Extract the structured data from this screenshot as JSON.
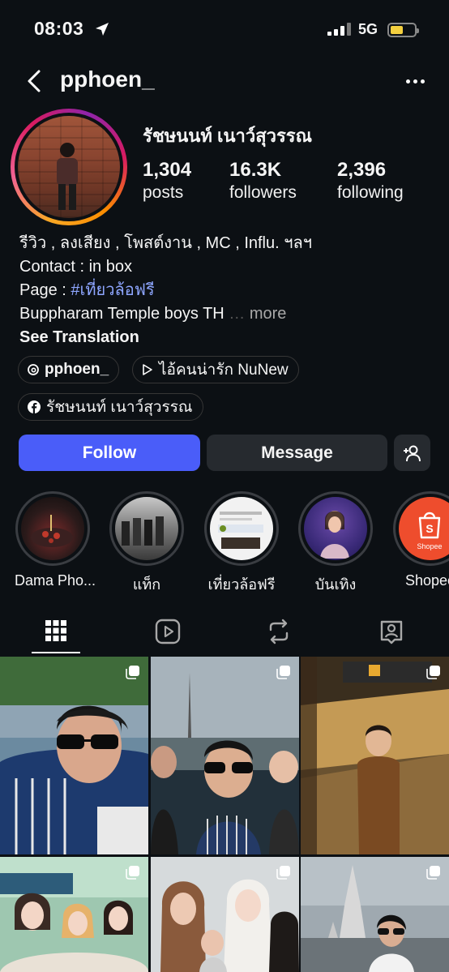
{
  "status_bar": {
    "time": "08:03",
    "network": "5G",
    "battery_color": "#f4d03f"
  },
  "header": {
    "username": "pphoen_"
  },
  "profile": {
    "full_name": "รัชษนนท์ เนาว์สุวรรณ",
    "stats": [
      {
        "value": "1,304",
        "label": "posts"
      },
      {
        "value": "16.3K",
        "label": "followers"
      },
      {
        "value": "2,396",
        "label": "following"
      }
    ],
    "bio": {
      "line1": "รีวิว , ลงเสียง , โพสต์งาน , MC  , Influ. ฯลฯ",
      "line2": "Contact : in box",
      "line3_prefix": "Page : ",
      "line3_hashtag": "#เที่ยวล้อฟรี",
      "line4": "Buppharam Temple boys TH",
      "more": "more",
      "see_translation": "See Translation"
    },
    "links": [
      {
        "icon": "threads-icon",
        "label": "pphoen_"
      },
      {
        "icon": "play-icon",
        "label": "ไอ้คนน่ารัก NuNew"
      },
      {
        "icon": "facebook-icon",
        "label": "รัชษนนท์ เนาว์สุวรรณ"
      }
    ]
  },
  "actions": {
    "follow": "Follow",
    "message": "Message",
    "follow_color": "#4a5df9"
  },
  "highlights": [
    {
      "label": "Dama Pho..."
    },
    {
      "label": "แท็ก"
    },
    {
      "label": "เที่ยวล้อฟรี"
    },
    {
      "label": "บันเทิง"
    },
    {
      "label": "Shopee"
    }
  ],
  "tabs": [
    {
      "icon": "grid-icon",
      "active": true
    },
    {
      "icon": "reels-icon",
      "active": false
    },
    {
      "icon": "reposts-icon",
      "active": false
    },
    {
      "icon": "tagged-icon",
      "active": false
    }
  ],
  "shopee_badge": "Shopee",
  "shopee_color": "#ee4d2d"
}
